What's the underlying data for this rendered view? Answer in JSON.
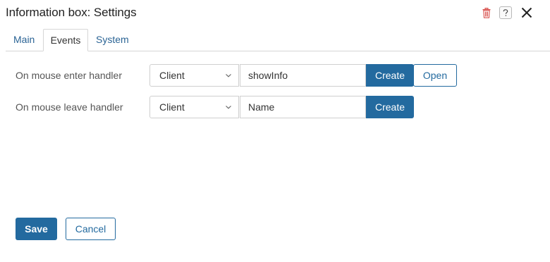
{
  "dialog": {
    "title": "Information box: Settings",
    "icons": {
      "delete": "trash-icon",
      "help": "question-icon",
      "close": "close-icon"
    },
    "colors": {
      "accent": "#236a9f",
      "delete_icon": "#d9534f"
    }
  },
  "tabs": [
    {
      "label": "Main",
      "active": false
    },
    {
      "label": "Events",
      "active": true
    },
    {
      "label": "System",
      "active": false
    }
  ],
  "handlers": [
    {
      "label": "On mouse enter handler",
      "scope": "Client",
      "value": "showInfo",
      "create_label": "Create",
      "open_label": "Open"
    },
    {
      "label": "On mouse leave handler",
      "scope": "Client",
      "value": "Name",
      "create_label": "Create"
    }
  ],
  "footer": {
    "save_label": "Save",
    "cancel_label": "Cancel"
  }
}
